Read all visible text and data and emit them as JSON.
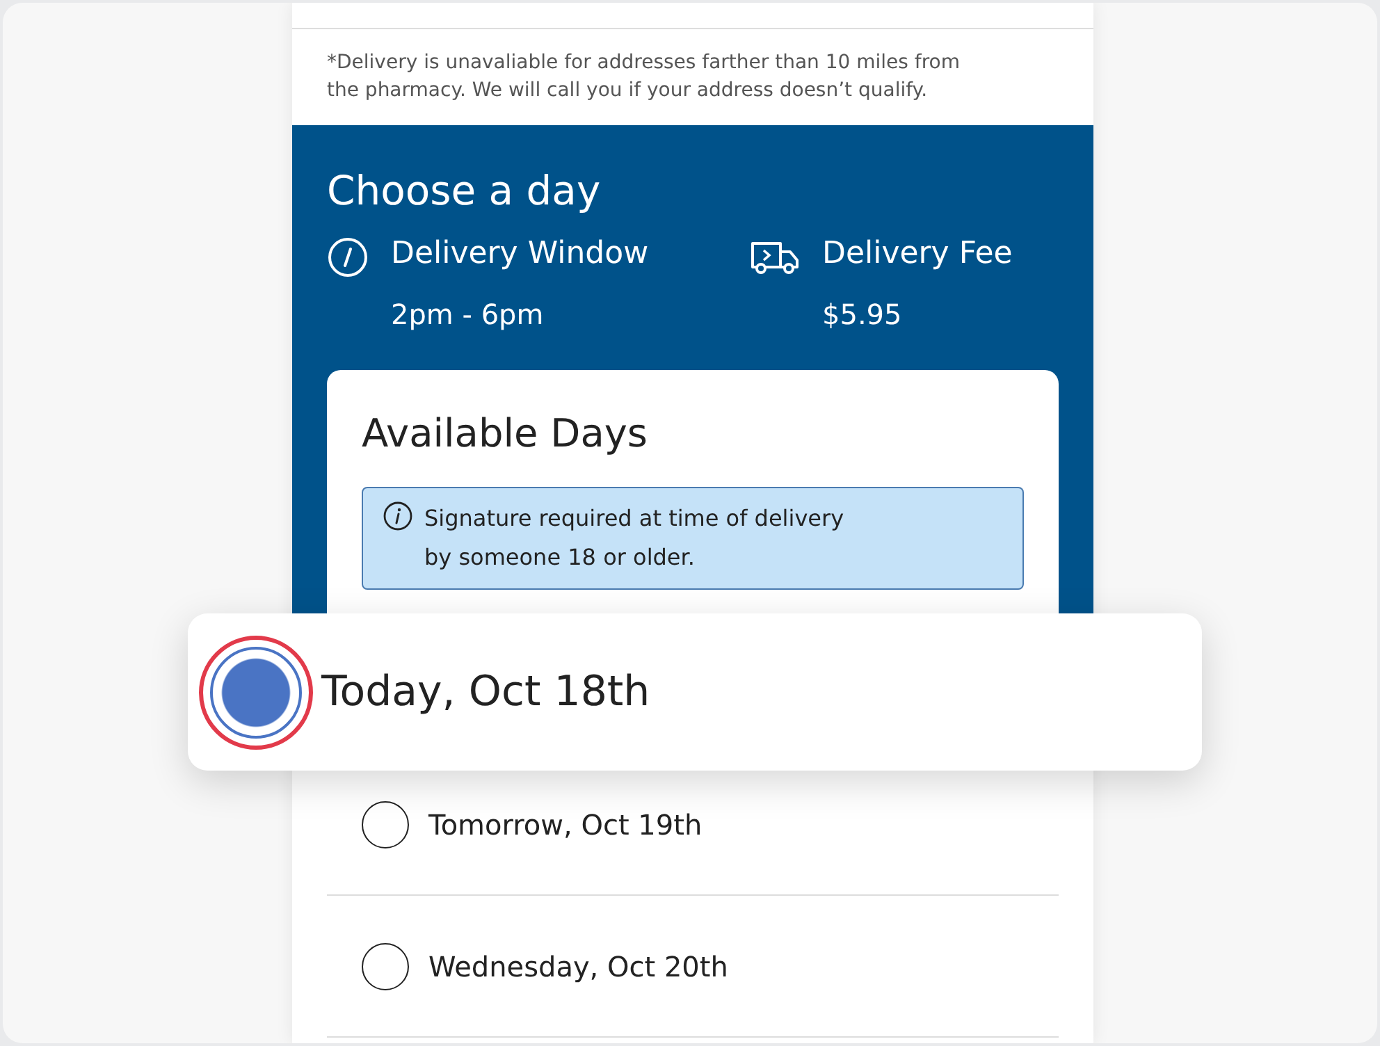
{
  "note": "*Delivery is unavaliable for addresses farther than 10 miles from the pharmacy. We will call you if your address doesn’t qualify.",
  "section": {
    "title": "Choose a day",
    "details": [
      {
        "kind": "clock",
        "label": "Delivery Window",
        "value": "2pm - 6pm"
      },
      {
        "kind": "truck",
        "label": "Delivery Fee",
        "value": "$5.95"
      }
    ]
  },
  "card": {
    "title": "Available Days",
    "info": "Signature required at time of delivery by someone 18 or older.",
    "days": [
      {
        "label": "Today, Oct 18th",
        "selected": true
      },
      {
        "label": "Tomorrow, Oct 19th",
        "selected": false
      },
      {
        "label": "Wednesday, Oct 20th",
        "selected": false
      }
    ]
  }
}
